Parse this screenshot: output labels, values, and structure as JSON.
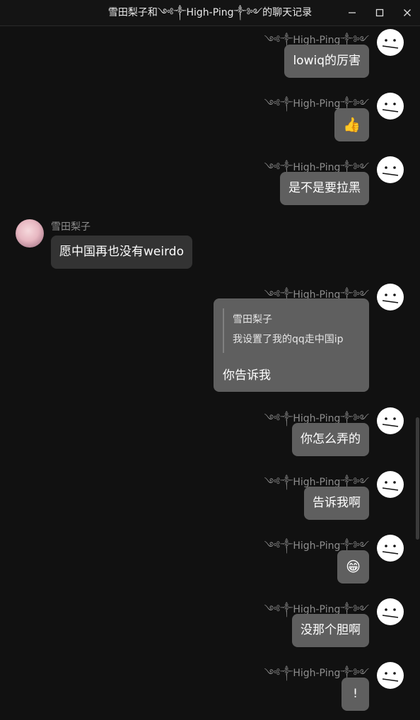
{
  "window": {
    "title": "雪田梨子和༺༒High-Ping༒༻的聊天记录",
    "controls": {
      "minimize": "minimize",
      "maximize": "maximize",
      "close": "close"
    }
  },
  "colors": {
    "background": "#111111",
    "bubble_self": "#5f5f5f",
    "bubble_other": "#333333",
    "name_text": "#8d8d8d"
  },
  "users": {
    "self": "༺༒High-Ping༒༻",
    "other": "雪田梨子"
  },
  "messages": [
    {
      "sender": "self",
      "text": "lowiq的厉害"
    },
    {
      "sender": "self",
      "text": "👍"
    },
    {
      "sender": "self",
      "text": "是不是要拉黑"
    },
    {
      "sender": "other",
      "text": "愿中国再也没有weirdo"
    },
    {
      "sender": "self",
      "quote": {
        "name": "雪田梨子",
        "text": "我设置了我的qq走中国ip"
      },
      "text": "你告诉我"
    },
    {
      "sender": "self",
      "text": "你怎么弄的"
    },
    {
      "sender": "self",
      "text": "告诉我啊"
    },
    {
      "sender": "self",
      "text": "😁"
    },
    {
      "sender": "self",
      "text": "没那个胆啊"
    },
    {
      "sender": "self",
      "text": "!"
    }
  ]
}
